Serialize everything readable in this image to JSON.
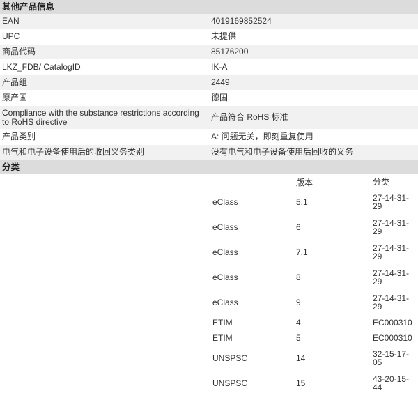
{
  "other_info": {
    "title": "其他产品信息",
    "rows": [
      {
        "label": "EAN",
        "value": "4019169852524"
      },
      {
        "label": "UPC",
        "value": "未提供"
      },
      {
        "label": "商品代码",
        "value": "85176200"
      },
      {
        "label": "LKZ_FDB/ CatalogID",
        "value": "IK-A"
      },
      {
        "label": "产品组",
        "value": "2449"
      },
      {
        "label": "原产国",
        "value": "德国"
      },
      {
        "label": "Compliance with the substance restrictions according to RoHS directive",
        "value": "产品符合 RoHS 标准"
      },
      {
        "label": "产品类别",
        "value": "A: 问题无关，即刻重复使用"
      },
      {
        "label": "电气和电子设备使用后的收回义务类别",
        "value": "没有电气和电子设备使用后回收的义务"
      }
    ]
  },
  "classification": {
    "title": "分类",
    "headers": {
      "system": "",
      "version": "版本",
      "category": "分类"
    },
    "rows": [
      {
        "system": "eClass",
        "version": "5.1",
        "category": "27-14-31-\n29"
      },
      {
        "system": "eClass",
        "version": "6",
        "category": "27-14-31-\n29"
      },
      {
        "system": "eClass",
        "version": "7.1",
        "category": "27-14-31-\n29"
      },
      {
        "system": "eClass",
        "version": "8",
        "category": "27-14-31-\n29"
      },
      {
        "system": "eClass",
        "version": "9",
        "category": "27-14-31-\n29"
      },
      {
        "system": "ETIM",
        "version": "4",
        "category": "EC000310"
      },
      {
        "system": "ETIM",
        "version": "5",
        "category": "EC000310"
      },
      {
        "system": "UNSPSC",
        "version": "14",
        "category": "32-15-17-\n05"
      },
      {
        "system": "UNSPSC",
        "version": "15",
        "category": "43-20-15-\n44"
      }
    ]
  }
}
